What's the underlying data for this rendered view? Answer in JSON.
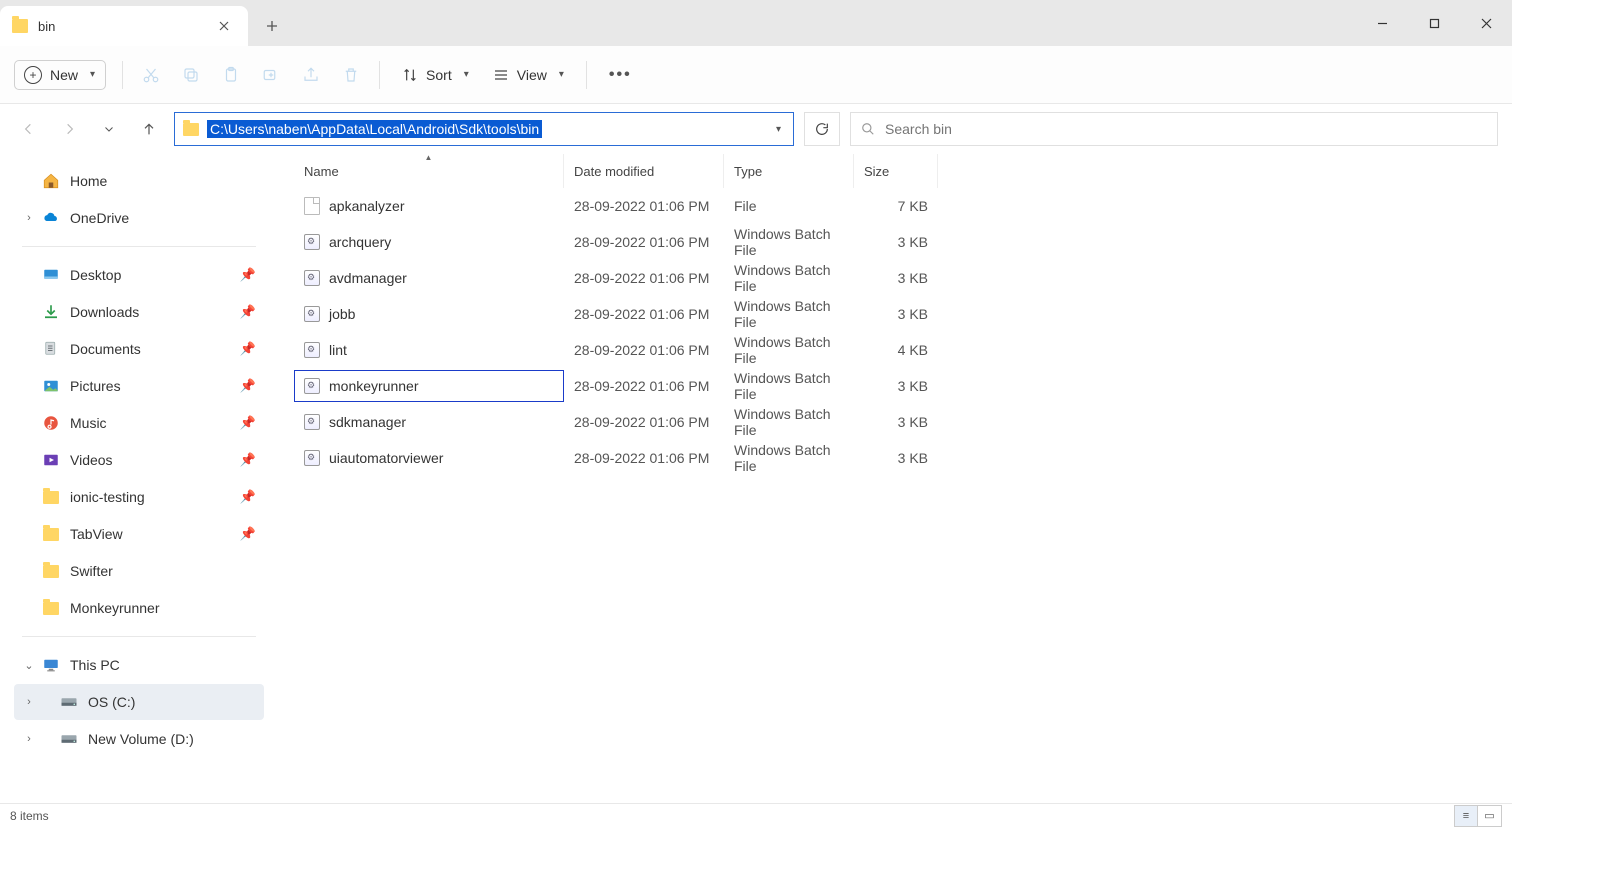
{
  "tab": {
    "title": "bin"
  },
  "toolbar": {
    "new": "New",
    "sort": "Sort",
    "view": "View"
  },
  "address": {
    "path": "C:\\Users\\naben\\AppData\\Local\\Android\\Sdk\\tools\\bin"
  },
  "search": {
    "placeholder": "Search bin"
  },
  "columns": {
    "name": "Name",
    "date": "Date modified",
    "type": "Type",
    "size": "Size"
  },
  "sidebar": {
    "top": [
      {
        "label": "Home",
        "icon": "home",
        "chev": ""
      },
      {
        "label": "OneDrive",
        "icon": "onedrive",
        "chev": "›"
      }
    ],
    "quick": [
      {
        "label": "Desktop",
        "icon": "desktop",
        "pinned": true
      },
      {
        "label": "Downloads",
        "icon": "downloads",
        "pinned": true
      },
      {
        "label": "Documents",
        "icon": "documents",
        "pinned": true
      },
      {
        "label": "Pictures",
        "icon": "pictures",
        "pinned": true
      },
      {
        "label": "Music",
        "icon": "music",
        "pinned": true
      },
      {
        "label": "Videos",
        "icon": "videos",
        "pinned": true
      },
      {
        "label": "ionic-testing",
        "icon": "folder",
        "pinned": true
      },
      {
        "label": "TabView",
        "icon": "folder",
        "pinned": true
      },
      {
        "label": "Swifter",
        "icon": "folder",
        "pinned": false
      },
      {
        "label": "Monkeyrunner",
        "icon": "folder",
        "pinned": false
      }
    ],
    "system": [
      {
        "label": "This PC",
        "icon": "thispc",
        "chev": "⌄",
        "indent": 0
      },
      {
        "label": "OS (C:)",
        "icon": "drive",
        "chev": "›",
        "indent": 1,
        "selected": true
      },
      {
        "label": "New Volume (D:)",
        "icon": "drive",
        "chev": "›",
        "indent": 1
      }
    ]
  },
  "files": [
    {
      "name": "apkanalyzer",
      "date": "28-09-2022 01:06 PM",
      "type": "File",
      "size": "7 KB",
      "icon": "file"
    },
    {
      "name": "archquery",
      "date": "28-09-2022 01:06 PM",
      "type": "Windows Batch File",
      "size": "3 KB",
      "icon": "bat"
    },
    {
      "name": "avdmanager",
      "date": "28-09-2022 01:06 PM",
      "type": "Windows Batch File",
      "size": "3 KB",
      "icon": "bat"
    },
    {
      "name": "jobb",
      "date": "28-09-2022 01:06 PM",
      "type": "Windows Batch File",
      "size": "3 KB",
      "icon": "bat"
    },
    {
      "name": "lint",
      "date": "28-09-2022 01:06 PM",
      "type": "Windows Batch File",
      "size": "4 KB",
      "icon": "bat"
    },
    {
      "name": "monkeyrunner",
      "date": "28-09-2022 01:06 PM",
      "type": "Windows Batch File",
      "size": "3 KB",
      "icon": "bat",
      "highlighted": true
    },
    {
      "name": "sdkmanager",
      "date": "28-09-2022 01:06 PM",
      "type": "Windows Batch File",
      "size": "3 KB",
      "icon": "bat"
    },
    {
      "name": "uiautomatorviewer",
      "date": "28-09-2022 01:06 PM",
      "type": "Windows Batch File",
      "size": "3 KB",
      "icon": "bat"
    }
  ],
  "status": {
    "items": "8 items"
  }
}
